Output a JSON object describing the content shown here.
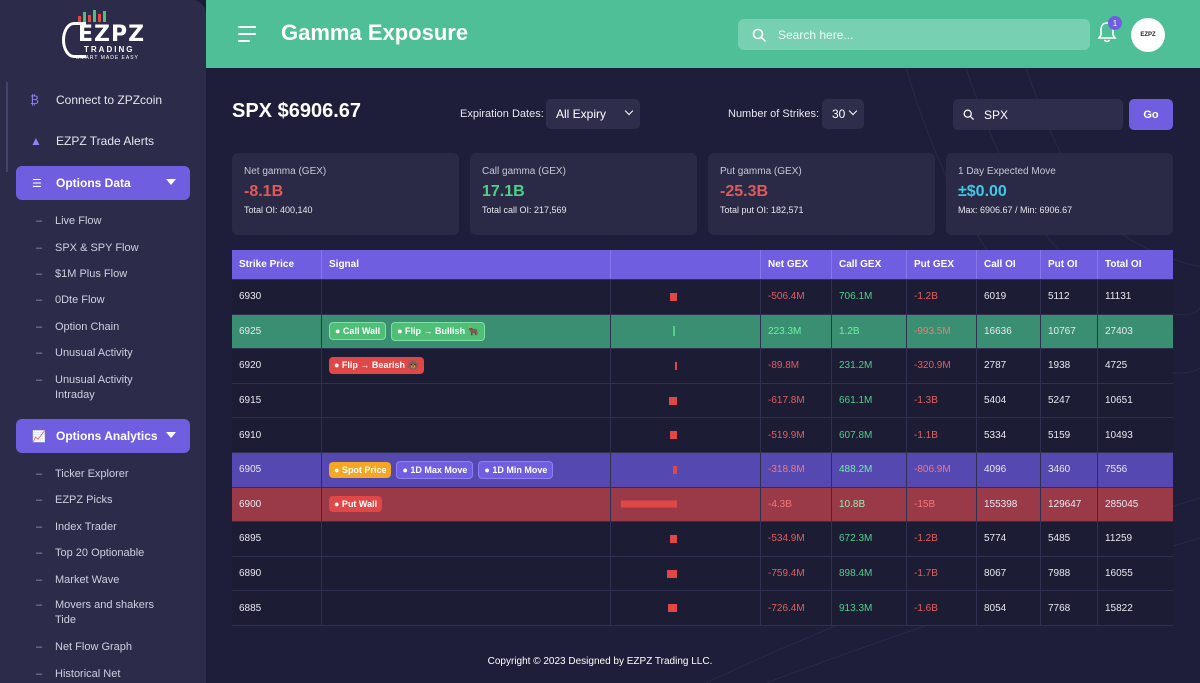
{
  "app": {
    "logo_title": "EZPZ",
    "logo_sub": "TRADING",
    "logo_tagline": "SMART MADE EASY"
  },
  "sidebar": {
    "top_items": [
      {
        "label": "Connect to ZPZcoin",
        "icon": "coin-icon"
      },
      {
        "label": "EZPZ Trade Alerts",
        "icon": "warning-icon"
      }
    ],
    "sections": [
      {
        "label": "Options Data",
        "icon": "list-icon",
        "items": [
          "Live Flow",
          "SPX & SPY Flow",
          "$1M Plus Flow",
          "0Dte Flow",
          "Option Chain",
          "Unusual Activity",
          "Unusual Activity Intraday"
        ]
      },
      {
        "label": "Options Analytics",
        "icon": "chart-icon",
        "items": [
          "Ticker Explorer",
          "EZPZ Picks",
          "Index Trader",
          "Top 20 Optionable",
          "Market Wave",
          "Movers and shakers Tide",
          "Net Flow Graph",
          "Historical Net"
        ]
      }
    ]
  },
  "header": {
    "title": "Gamma Exposure",
    "search_placeholder": "Search here...",
    "notification_count": "1",
    "avatar_text": "EZPZ"
  },
  "controls": {
    "ticker_price": "SPX $6906.67",
    "expiration_label": "Expiration Dates:",
    "expiration_value": "All Expiry",
    "strikes_label": "Number of Strikes:",
    "strikes_value": "30",
    "ticker_value": "SPX",
    "go_label": "Go"
  },
  "cards": [
    {
      "label": "Net gamma (GEX)",
      "value": "-8.1B",
      "sub": "Total OI: 400,140",
      "color": "#e05a5a"
    },
    {
      "label": "Call gamma (GEX)",
      "value": "17.1B",
      "sub": "Total call OI: 217,569",
      "color": "#4fd08a"
    },
    {
      "label": "Put gamma (GEX)",
      "value": "-25.3B",
      "sub": "Total put OI: 182,571",
      "color": "#e05a5a"
    },
    {
      "label": "1 Day Expected Move",
      "value": "±$0.00",
      "sub": "Max: 6906.67 / Min: 6906.67",
      "color": "#3fc8e8"
    }
  ],
  "table": {
    "headers": [
      "Strike Price",
      "Signal",
      "",
      "Net GEX",
      "Call GEX",
      "Put GEX",
      "Call OI",
      "Put OI",
      "Total OI"
    ],
    "rows": [
      {
        "strike": "6930",
        "style": "normal",
        "signals": [],
        "net_gex": "-506.4M",
        "call_gex": "706.1M",
        "put_gex": "-1.2B",
        "call_oi": "6019",
        "put_oi": "5112",
        "total_oi": "11131",
        "bar_value": -0.0506,
        "bar_color": "#e04848"
      },
      {
        "strike": "6925",
        "style": "green",
        "signals": [
          {
            "text": "● Call Wall",
            "kind": "green"
          },
          {
            "text": "● Flip → Bullish 🐂",
            "kind": "green"
          }
        ],
        "net_gex": "223.3M",
        "call_gex": "1.2B",
        "put_gex": "-993.5M",
        "call_oi": "16636",
        "put_oi": "10767",
        "total_oi": "27403",
        "bar_value": 0.0223,
        "bar_color": "#4fd08a"
      },
      {
        "strike": "6920",
        "style": "normal",
        "signals": [
          {
            "text": "● Flip → Bearish 🐻",
            "kind": "red"
          }
        ],
        "net_gex": "-89.8M",
        "call_gex": "231.2M",
        "put_gex": "-320.9M",
        "call_oi": "2787",
        "put_oi": "1938",
        "total_oi": "4725",
        "bar_value": -0.009,
        "bar_color": "#e04848"
      },
      {
        "strike": "6915",
        "style": "normal",
        "signals": [],
        "net_gex": "-617.8M",
        "call_gex": "661.1M",
        "put_gex": "-1.3B",
        "call_oi": "5404",
        "put_oi": "5247",
        "total_oi": "10651",
        "bar_value": -0.0618,
        "bar_color": "#e04848"
      },
      {
        "strike": "6910",
        "style": "normal",
        "signals": [],
        "net_gex": "-519.9M",
        "call_gex": "607.8M",
        "put_gex": "-1.1B",
        "call_oi": "5334",
        "put_oi": "5159",
        "total_oi": "10493",
        "bar_value": -0.052,
        "bar_color": "#e04848"
      },
      {
        "strike": "6905",
        "style": "purple",
        "signals": [
          {
            "text": "● Spot Price",
            "kind": "orange"
          },
          {
            "text": "● 1D Max Move",
            "kind": "purple"
          },
          {
            "text": "● 1D Min Move",
            "kind": "purple"
          }
        ],
        "net_gex": "-318.8M",
        "call_gex": "488.2M",
        "put_gex": "-806.9M",
        "call_oi": "4096",
        "put_oi": "3460",
        "total_oi": "7556",
        "bar_value": -0.0319,
        "bar_color": "#e04848"
      },
      {
        "strike": "6900",
        "style": "red",
        "signals": [
          {
            "text": "● Put Wall",
            "kind": "red"
          }
        ],
        "net_gex": "-4.3B",
        "call_gex": "10.8B",
        "put_gex": "-15B",
        "call_oi": "155398",
        "put_oi": "129647",
        "total_oi": "285045",
        "bar_value": -0.43,
        "bar_color": "#e04848"
      },
      {
        "strike": "6895",
        "style": "normal",
        "signals": [],
        "net_gex": "-534.9M",
        "call_gex": "672.3M",
        "put_gex": "-1.2B",
        "call_oi": "5774",
        "put_oi": "5485",
        "total_oi": "11259",
        "bar_value": -0.0535,
        "bar_color": "#e04848"
      },
      {
        "strike": "6890",
        "style": "normal",
        "signals": [],
        "net_gex": "-759.4M",
        "call_gex": "898.4M",
        "put_gex": "-1.7B",
        "call_oi": "8067",
        "put_oi": "7988",
        "total_oi": "16055",
        "bar_value": -0.0759,
        "bar_color": "#e04848"
      },
      {
        "strike": "6885",
        "style": "normal",
        "signals": [],
        "net_gex": "-726.4M",
        "call_gex": "913.3M",
        "put_gex": "-1.6B",
        "call_oi": "8054",
        "put_oi": "7768",
        "total_oi": "15822",
        "bar_value": -0.0726,
        "bar_color": "#e04848"
      }
    ]
  },
  "footer": {
    "text": "Copyright © 2023 Designed by EZPZ Trading LLC."
  }
}
